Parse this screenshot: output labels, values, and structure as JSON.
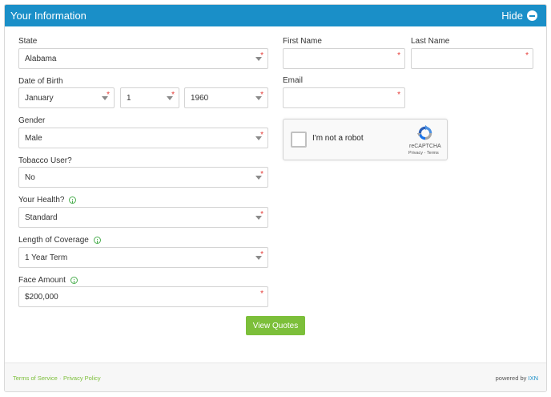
{
  "header": {
    "title": "Your Information",
    "hide_label": "Hide"
  },
  "fields": {
    "state": {
      "label": "State",
      "value": "Alabama"
    },
    "dob": {
      "label": "Date of Birth",
      "month": "January",
      "day": "1",
      "year": "1960"
    },
    "gender": {
      "label": "Gender",
      "value": "Male"
    },
    "tobacco": {
      "label": "Tobacco User?",
      "value": "No"
    },
    "health": {
      "label": "Your Health?",
      "value": "Standard"
    },
    "coverage": {
      "label": "Length of Coverage",
      "value": "1 Year Term"
    },
    "face": {
      "label": "Face Amount",
      "value": "$200,000"
    },
    "first_name": {
      "label": "First Name",
      "value": ""
    },
    "last_name": {
      "label": "Last Name",
      "value": ""
    },
    "email": {
      "label": "Email",
      "value": ""
    }
  },
  "required_marker": "*",
  "captcha": {
    "text": "I'm not a robot",
    "brand": "reCAPTCHA",
    "links": "Privacy - Terms"
  },
  "submit_label": "View Quotes",
  "footer": {
    "terms": "Terms of Service",
    "separator": "·",
    "privacy": "Privacy Policy",
    "powered_by": "powered by",
    "brand": "IXN"
  },
  "colors": {
    "header": "#1a8fc8",
    "button": "#7cbf3a",
    "required": "#e53935",
    "link": "#7cbf3a"
  }
}
